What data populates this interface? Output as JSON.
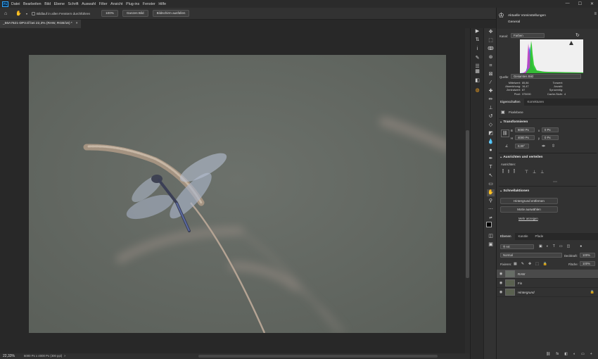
{
  "menu": [
    "Datei",
    "Bearbeiten",
    "Bild",
    "Ebene",
    "Schrift",
    "Auswahl",
    "Filter",
    "Ansicht",
    "Plug-ins",
    "Fenster",
    "Hilfe"
  ],
  "app_logo": "Ps",
  "window_controls": [
    "—",
    "☐",
    "✕"
  ],
  "options": {
    "scroll_all_label": "Bildlauf in allen Fenstern durchführen",
    "zoom100": "100%",
    "fit": "Ganzes Bild",
    "fill": "Bildschirm ausfüllen"
  },
  "document": {
    "tab_title": "_56A7621-DP3.tif bei 22,3% (RAW, RGB/16) *",
    "close": "×"
  },
  "status": {
    "zoom": "22,33%",
    "info": "6000 Px x 4000 Px (300 ppi)"
  },
  "learn": {
    "title": "Aktuelle Voreinstellungen",
    "subtitle": "General"
  },
  "histogram": {
    "channel_label": "Kanal:",
    "channel_value": "Farben",
    "source_label": "Quelle:",
    "source_value": "Gesamtes Bild",
    "stats_left_labels": [
      "Mittelwert:",
      "Abweichung:",
      "Zentralwert:",
      "Pixel:"
    ],
    "stats_left_values": [
      "85,86",
      "16,47",
      "87",
      "375000"
    ],
    "stats_right_labels": [
      "Tonwert:",
      "Anzahl:",
      "Sprozentig:",
      "Cache-Stufe:"
    ],
    "stats_right_values": [
      "",
      "",
      "",
      "4"
    ]
  },
  "properties": {
    "tab_active": "Eigenschaften",
    "tab_other": "Korrekturen",
    "layer_type": "Pixelebene",
    "transform_title": "Transformieren",
    "w_label": "B",
    "w_value": "6000 Px",
    "x_label": "x",
    "x_value": "0 Px",
    "h_label": "H",
    "h_value": "4000 Px",
    "y_label": "y",
    "y_value": "0 Px",
    "angle_value": "0,00°",
    "align_title": "Ausrichten und verteilen",
    "align_sub": "Ausrichten:",
    "quick_title": "Schnellaktionen",
    "btn_remove_bg": "Hintergrund entfernen",
    "btn_select_subject": "Motiv auswählen",
    "more_link": "Mehr anzeigen"
  },
  "layers": {
    "tabs": [
      "Ebenen",
      "Kanäle",
      "Pfade"
    ],
    "filter_value": "Art",
    "blend_mode": "Normal",
    "opacity_label": "Deckkraft:",
    "opacity_value": "100%",
    "lock_label": "Fixieren:",
    "fill_label": "Fläche:",
    "fill_value": "100%",
    "items": [
      {
        "name": "RAW",
        "selected": true
      },
      {
        "name": "Fin",
        "selected": false
      },
      {
        "name": "Hintergrund",
        "selected": false
      }
    ],
    "bottom_icons": [
      "fx",
      "◧",
      "◐",
      "▭",
      "+",
      "🗑"
    ]
  },
  "colors": {
    "photo_bg": "#676d66",
    "accent": "#31a8ff"
  }
}
